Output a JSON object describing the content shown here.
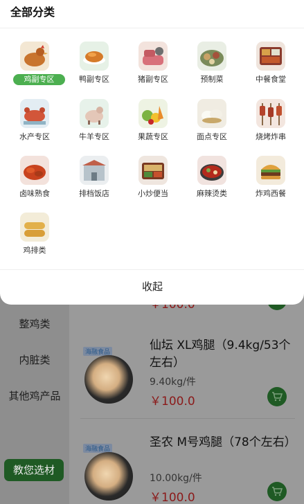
{
  "panel": {
    "title": "全部分类",
    "collapse_label": "收起",
    "categories": [
      {
        "label": "鸡副专区",
        "icon": "chicken-icon",
        "active": true
      },
      {
        "label": "鸭副专区",
        "icon": "duck-icon",
        "active": false
      },
      {
        "label": "猪副专区",
        "icon": "pork-icon",
        "active": false
      },
      {
        "label": "预制菜",
        "icon": "prepared-dish-icon",
        "active": false
      },
      {
        "label": "中餐食堂",
        "icon": "bento-icon",
        "active": false
      },
      {
        "label": "水产专区",
        "icon": "seafood-icon",
        "active": false
      },
      {
        "label": "牛羊专区",
        "icon": "cattle-sheep-icon",
        "active": false
      },
      {
        "label": "果蔬专区",
        "icon": "fruit-veg-icon",
        "active": false
      },
      {
        "label": "面点专区",
        "icon": "bun-icon",
        "active": false
      },
      {
        "label": "烧烤炸串",
        "icon": "skewer-icon",
        "active": false
      },
      {
        "label": "卤味熟食",
        "icon": "braised-food-icon",
        "active": false
      },
      {
        "label": "排档饭店",
        "icon": "restaurant-icon",
        "active": false
      },
      {
        "label": "小炒便当",
        "icon": "stir-fry-icon",
        "active": false
      },
      {
        "label": "麻辣烫类",
        "icon": "hotpot-icon",
        "active": false
      },
      {
        "label": "炸鸡西餐",
        "icon": "burger-icon",
        "active": false
      },
      {
        "label": "鸡排类",
        "icon": "chicken-cutlet-icon",
        "active": false
      }
    ]
  },
  "sidebar": {
    "items": [
      "整鸡类",
      "内脏类",
      "其他鸡产品"
    ],
    "guide_button": "教您选材"
  },
  "peek": {
    "price": "￥100.0"
  },
  "products": [
    {
      "logo": "海融食品",
      "title": "仙坛 XL鸡腿（9.4kg/53个左右）",
      "spec": "9.40kg/件",
      "price": "￥100.0"
    },
    {
      "logo": "海融食品",
      "title": "圣农 M号鸡腿（78个左右）",
      "spec": "10.00kg/件",
      "price": "￥100.0"
    }
  ],
  "colors": {
    "accent": "#4caf50",
    "price": "#c0392b",
    "dark_green": "#2e7d32"
  }
}
